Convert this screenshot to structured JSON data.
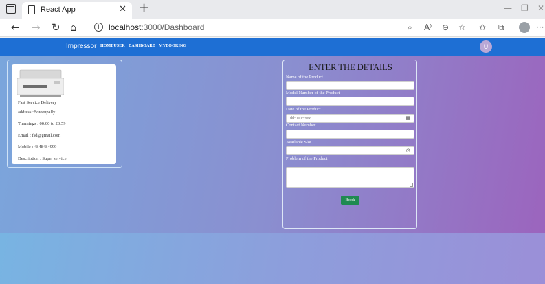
{
  "browser": {
    "tab_title": "React App",
    "tab_close": "✕",
    "new_tab": "+",
    "url_host": "localhost",
    "url_path": ":3000/Dashboard",
    "info_glyph": "i",
    "icons": [
      "back-icon",
      "forward-icon",
      "refresh-icon",
      "home-icon",
      "info-icon",
      "search-icon",
      "read-aloud-icon",
      "zoom-icon",
      "favorite-icon",
      "favorites-icon",
      "collections-icon",
      "profile-icon",
      "more-icon"
    ]
  },
  "navbar": {
    "brand": "Impressor",
    "links": [
      "HOMEUSER",
      "DASHBOARD",
      "MYBOOKING"
    ],
    "avatar_letter": "U",
    "color": "#1e6fd4"
  },
  "card": {
    "title": "Fast Service Delivery",
    "address": "address :Bowenpally",
    "timings": "Timmings : 00:00 to 23:59",
    "email": "Email : fsd@gmail.com",
    "mobile": "Mobile : 4848484999",
    "description": "Description : Super service"
  },
  "form": {
    "title": "ENTER THE DETAILS",
    "product_name_label": "Name of the Product",
    "model_label": "Model Number of the Product",
    "date_label": "Date of the Product",
    "date_placeholder": "dd-mm-yyyy",
    "contact_label": "Contact Number",
    "slot_label": "Available Slot",
    "slot_placeholder": "--:--",
    "problem_label": "Problem of the Product",
    "book_label": "Book",
    "book_color": "#1f8a50"
  }
}
